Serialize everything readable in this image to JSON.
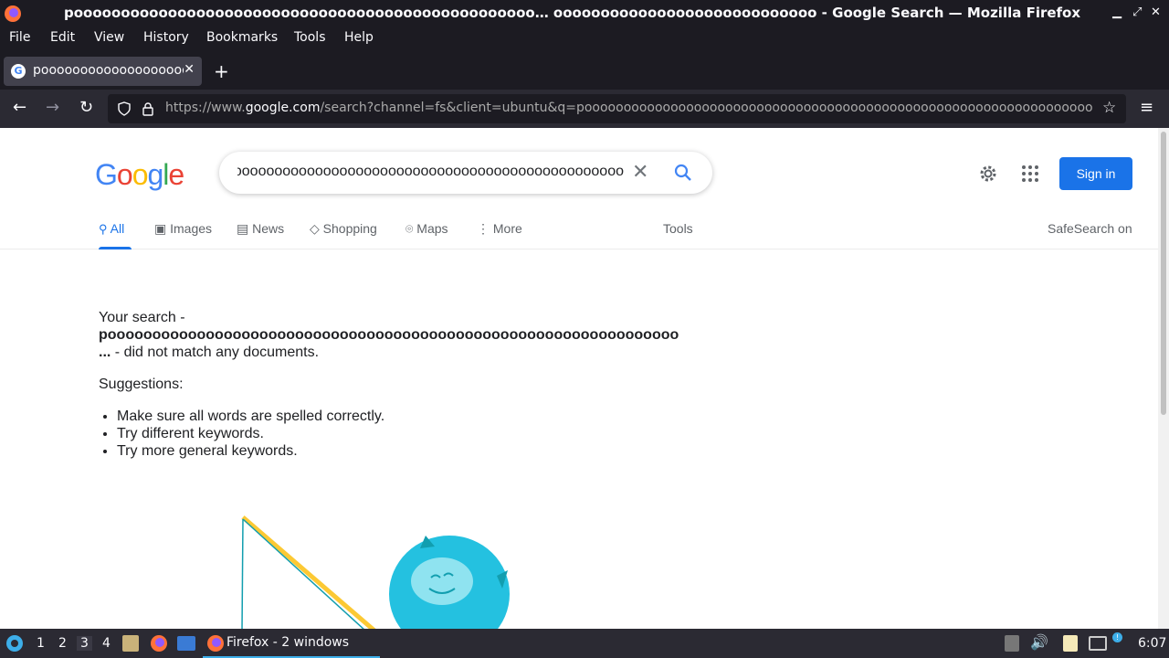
{
  "window": {
    "title": "pooooooooooooooooooooooooooooooooooooooooooooooooo… oooooooooooooooooooooooooooo - Google Search — Mozilla Firefox"
  },
  "menu": [
    "File",
    "Edit",
    "View",
    "History",
    "Bookmarks",
    "Tools",
    "Help"
  ],
  "tab": {
    "title": "pooooooooooooooooooooooooooooooooo"
  },
  "url": {
    "prefix": "https://www.",
    "domain": "google.com",
    "path": "/search?channel=fs&client=ubuntu&q=poooooooooooooooooooooooooooooooooooooooooooooooooooooooooooooooooooooooo"
  },
  "search": {
    "query": "poooooooooooooooooooooooooooooooooooooooooooooooooooooooooooooooooo"
  },
  "header": {
    "signin_label": "Sign in"
  },
  "nav_tabs": {
    "all": "All",
    "images": "Images",
    "news": "News",
    "shopping": "Shopping",
    "maps": "Maps",
    "more": "More",
    "tools": "Tools",
    "safesearch": "SafeSearch on"
  },
  "results": {
    "intro": "Your search -",
    "query_bold": "poooooooooooooooooooooooooooooooooooooooooooooooooooooooooooooooo",
    "ellipsis": "...",
    "no_match": " - did not match any documents.",
    "suggestions_heading": "Suggestions:",
    "suggestions": [
      "Make sure all words are spelled correctly.",
      "Try different keywords.",
      "Try more general keywords."
    ]
  },
  "taskbar": {
    "workspaces": [
      "1",
      "2",
      "3",
      "4"
    ],
    "task_label": "Firefox - 2 windows",
    "clock": "6:07"
  },
  "colors": {
    "google_blue": "#4285f4",
    "google_red": "#ea4335",
    "google_yellow": "#fbbc05",
    "google_green": "#34a853",
    "button_blue": "#1a73e8"
  }
}
